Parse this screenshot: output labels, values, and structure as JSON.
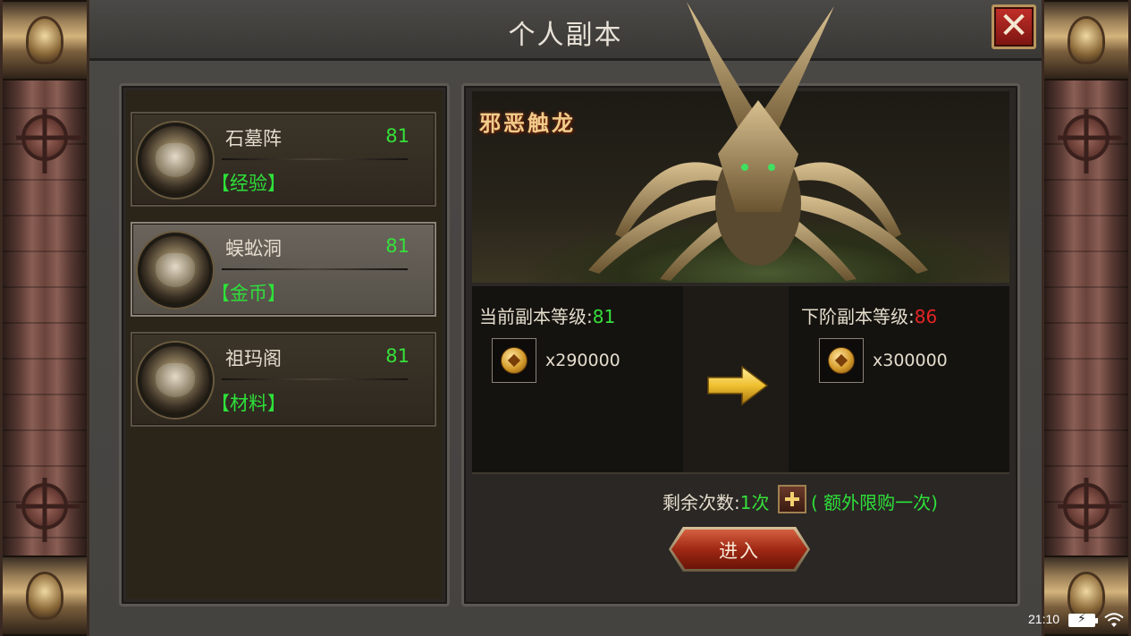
{
  "window": {
    "title": "个人副本",
    "close_icon": "close-icon"
  },
  "dungeons": [
    {
      "name": "石墓阵",
      "level": "81",
      "tag": "【经验】",
      "selected": false
    },
    {
      "name": "蜈蚣洞",
      "level": "81",
      "tag": "【金币】",
      "selected": true
    },
    {
      "name": "祖玛阁",
      "level": "81",
      "tag": "【材料】",
      "selected": false
    }
  ],
  "boss": {
    "name": "邪恶触龙"
  },
  "current": {
    "label": "当前副本等级:",
    "level": "81",
    "cost": "x290000",
    "cost_icon": "gold-coin-icon"
  },
  "next": {
    "label": "下阶副本等级:",
    "level": "86",
    "cost": "x300000",
    "cost_icon": "gold-coin-icon"
  },
  "remaining": {
    "label": "剩余次数:",
    "count": "1次",
    "extra": "( 额外限购一次)"
  },
  "enter_button": "进入",
  "status_bar": {
    "time": "21:10",
    "battery_icon": "battery-charging-icon",
    "wifi_icon": "wifi-icon"
  },
  "colors": {
    "level_green": "#36e03a",
    "level_red": "#e82424",
    "tag_green": "#2ee03a"
  }
}
